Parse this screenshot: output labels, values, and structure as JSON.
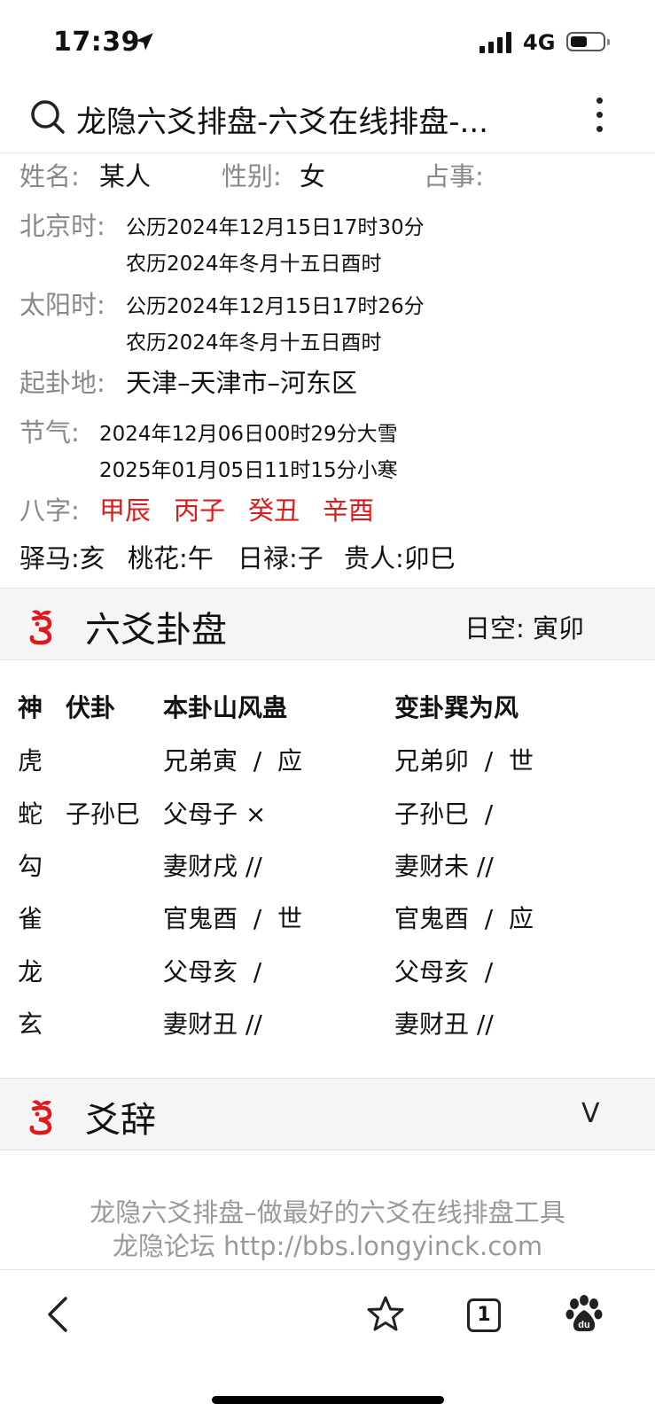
{
  "status_bar": {
    "time": "17:39",
    "network": "4G"
  },
  "browser": {
    "title": "龙隐六爻排盘-六爻在线排盘-..."
  },
  "info": {
    "name_label": "姓名:",
    "name_value": "某人",
    "gender_label": "性别:",
    "gender_value": "女",
    "matter_label": "占事:",
    "beijing_label": "北京时:",
    "beijing_solar": "公历2024年12月15日17时30分",
    "beijing_lunar": "农历2024年冬月十五日酉时",
    "sun_label": "太阳时:",
    "sun_solar": "公历2024年12月15日17时26分",
    "sun_lunar": "农历2024年冬月十五日酉时",
    "place_label": "起卦地:",
    "place_value": "天津–天津市–河东区",
    "jieqi_label": "节气:",
    "jieqi_1": "2024年12月06日00时29分大雪",
    "jieqi_2": "2025年01月05日11时15分小寒",
    "bazi_label": "八字:",
    "bazi": [
      "甲辰",
      "丙子",
      "癸丑",
      "辛酉"
    ],
    "shensha": [
      "驿马:亥",
      "桃花:午",
      "日禄:子",
      "贵人:卯巳"
    ]
  },
  "guapan": {
    "title": "六爻卦盘",
    "rikong": "日空:  寅卯",
    "headers": {
      "shen": "神",
      "fugua": "伏卦",
      "bengua": "本卦山风蛊",
      "biangua": "变卦巽为风"
    },
    "rows": [
      {
        "shen": "虎",
        "fu": "",
        "ben": "兄弟寅  /  应",
        "bian": "兄弟卯  /  世"
      },
      {
        "shen": "蛇",
        "fu": "子孙巳",
        "ben": "父母子 ×",
        "bian": "子孙巳  /"
      },
      {
        "shen": "勾",
        "fu": "",
        "ben": "妻财戌 //",
        "bian": "妻财未 //"
      },
      {
        "shen": "雀",
        "fu": "",
        "ben": "官鬼酉  /  世",
        "bian": "官鬼酉  /  应"
      },
      {
        "shen": "龙",
        "fu": "",
        "ben": "父母亥  /",
        "bian": "父母亥  /"
      },
      {
        "shen": "玄",
        "fu": "",
        "ben": "妻财丑 //",
        "bian": "妻财丑 //"
      }
    ]
  },
  "yaoci": {
    "title": "爻辞",
    "chevron": "V"
  },
  "footer": {
    "line1": "龙隐六爻排盘–做最好的六爻在线排盘工具",
    "line2": "龙隐论坛 http://bbs.longyinck.com"
  },
  "bottom_nav": {
    "tabs_count": "1"
  }
}
